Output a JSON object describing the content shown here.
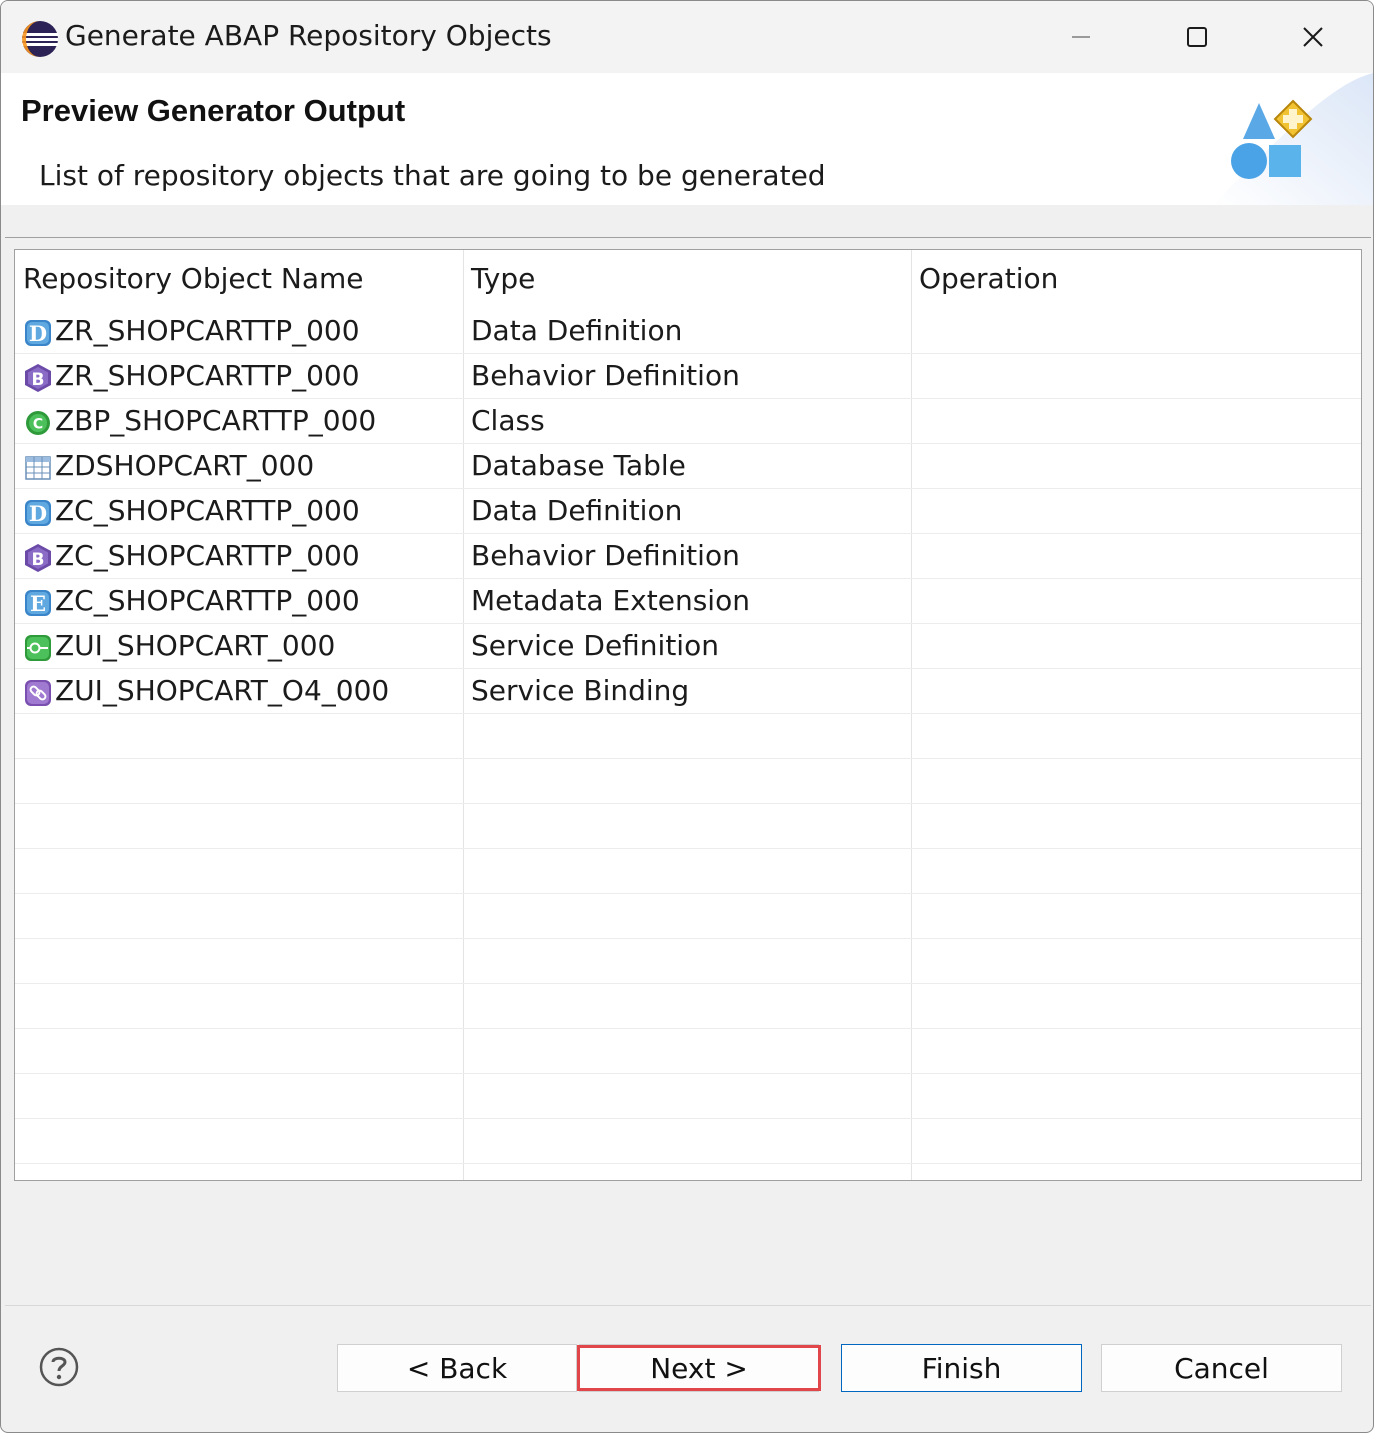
{
  "window": {
    "title": "Generate ABAP Repository Objects",
    "controls": {
      "minimize": "minimize-icon",
      "maximize": "maximize-icon",
      "close": "close-icon"
    }
  },
  "header": {
    "title": "Preview Generator Output",
    "description": "List of repository objects that are going to be generated"
  },
  "table": {
    "columns": [
      "Repository Object Name",
      "Type",
      "Operation"
    ],
    "rows": [
      {
        "icon": "data-definition-icon",
        "name": "ZR_SHOPCARTTP_000",
        "type": "Data Definition",
        "operation": ""
      },
      {
        "icon": "behavior-definition-icon",
        "name": "ZR_SHOPCARTTP_000",
        "type": "Behavior Definition",
        "operation": ""
      },
      {
        "icon": "class-icon",
        "name": "ZBP_SHOPCARTTP_000",
        "type": "Class",
        "operation": ""
      },
      {
        "icon": "database-table-icon",
        "name": "ZDSHOPCART_000",
        "type": "Database Table",
        "operation": ""
      },
      {
        "icon": "data-definition-icon",
        "name": "ZC_SHOPCARTTP_000",
        "type": "Data Definition",
        "operation": ""
      },
      {
        "icon": "behavior-definition-icon",
        "name": "ZC_SHOPCARTTP_000",
        "type": "Behavior Definition",
        "operation": ""
      },
      {
        "icon": "metadata-extension-icon",
        "name": "ZC_SHOPCARTTP_000",
        "type": "Metadata Extension",
        "operation": ""
      },
      {
        "icon": "service-definition-icon",
        "name": "ZUI_SHOPCART_000",
        "type": "Service Definition",
        "operation": ""
      },
      {
        "icon": "service-binding-icon",
        "name": "ZUI_SHOPCART_O4_000",
        "type": "Service Binding",
        "operation": ""
      }
    ]
  },
  "footer": {
    "help_icon": "help-icon",
    "back_label": "< Back",
    "next_label": "Next >",
    "finish_label": "Finish",
    "cancel_label": "Cancel"
  },
  "colors": {
    "highlight": "#e1474a",
    "default_button_border": "#0067c0"
  }
}
